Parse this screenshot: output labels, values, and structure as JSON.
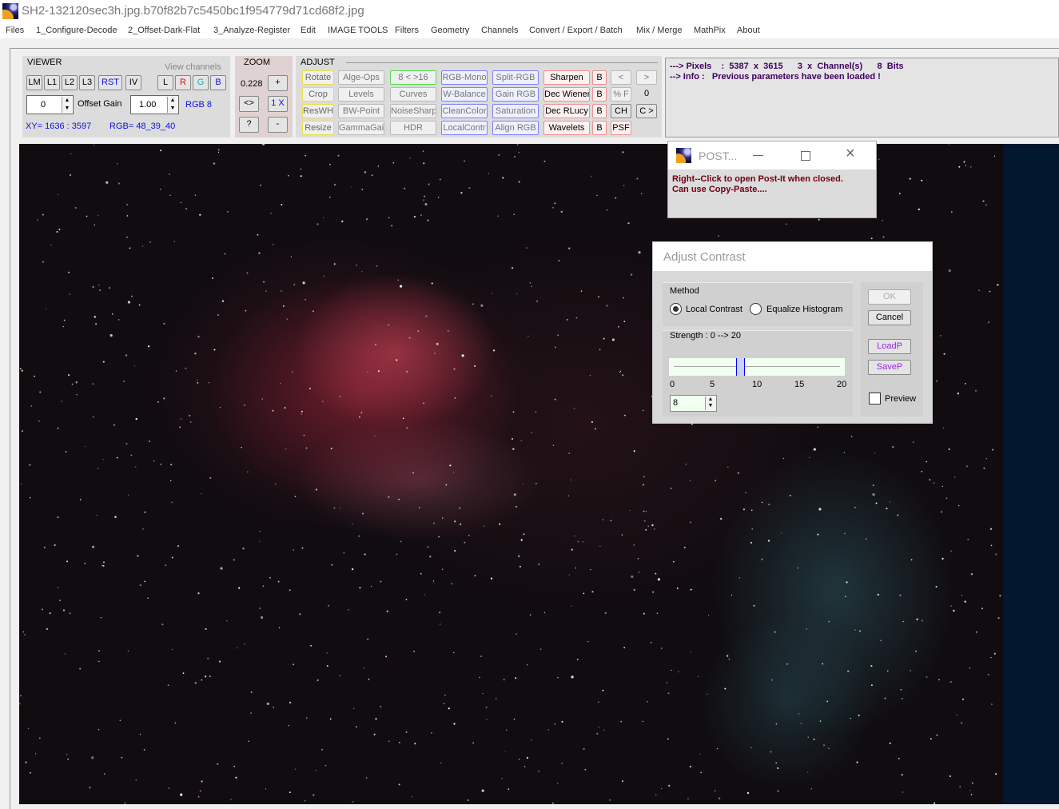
{
  "window": {
    "title": "SH2-132120sec3h.jpg.b70f82b7c5450bc1f954779d71cd68f2.jpg"
  },
  "menu": [
    "Files",
    "1_Configure-Decode",
    "2_Offset-Dark-Flat",
    "3_Analyze-Register",
    "Edit",
    "IMAGE TOOLS",
    "Filters",
    "Geometry",
    "Channels",
    "Convert / Export / Batch",
    "Mix / Merge",
    "MathPix",
    "About"
  ],
  "viewer": {
    "title": "VIEWER",
    "view_channels": "View channels",
    "buttons": [
      "LM",
      "L1",
      "L2",
      "L3",
      "RST",
      "IV"
    ],
    "channels": [
      "L",
      "R",
      "G",
      "B"
    ],
    "offset_value": "0",
    "offset_gain_label": "Offset  Gain",
    "gain_value": "1.00",
    "rgb_bits": "RGB 8",
    "xy": "XY=  1636 : 3597",
    "rgb": "RGB=  48_39_40"
  },
  "zoom": {
    "title": "ZOOM",
    "value": "0.228",
    "plus": "+",
    "fit": "<>",
    "one": "1 X",
    "help": "?",
    "minus": "-"
  },
  "adjust": {
    "title": "ADJUST",
    "buttons": [
      [
        "Rotate",
        "Alge-Ops",
        "8 < >16",
        "RGB-Mono",
        "Split-RGB",
        "Sharpen",
        "B",
        "<",
        ">"
      ],
      [
        "Crop",
        "Levels",
        "Curves",
        "W-Balance",
        "Gain RGB",
        "Dec Wiener",
        "B",
        "% F",
        "0"
      ],
      [
        "ResWH",
        "BW-Point",
        "NoiseSharp",
        "CleanColor",
        "Saturation",
        "Dec RLucy",
        "B",
        "CH",
        "C >"
      ],
      [
        "Resize",
        "GammaGain",
        "HDR",
        "LocalContr",
        "Align RGB",
        "Wavelets",
        "B",
        "PSF"
      ]
    ]
  },
  "info": {
    "line1": "---> Pixels    :  5387  x  3615      3  x  Channel(s)      8  Bits",
    "line2": "--> Info :   Previous parameters have been loaded !"
  },
  "postit": {
    "title": "POST...",
    "message1": "Right--Click to open  Post-It when closed.",
    "message2": "Can use Copy-Paste...."
  },
  "dialog": {
    "title": "Adjust Contrast",
    "method_label": "Method",
    "method_options": [
      "Local Contrast",
      "Equalize Histogram"
    ],
    "method_selected": "Local Contrast",
    "strength_label": "Strength :  0 --> 20",
    "slider": {
      "min": 0,
      "max": 20,
      "value": 8
    },
    "ticks": [
      "0",
      "5",
      "10",
      "15",
      "20"
    ],
    "strength_value": "8",
    "ok": "OK",
    "cancel": "Cancel",
    "loadp": "LoadP",
    "savep": "SaveP",
    "preview_label": "Preview",
    "preview_checked": false
  }
}
